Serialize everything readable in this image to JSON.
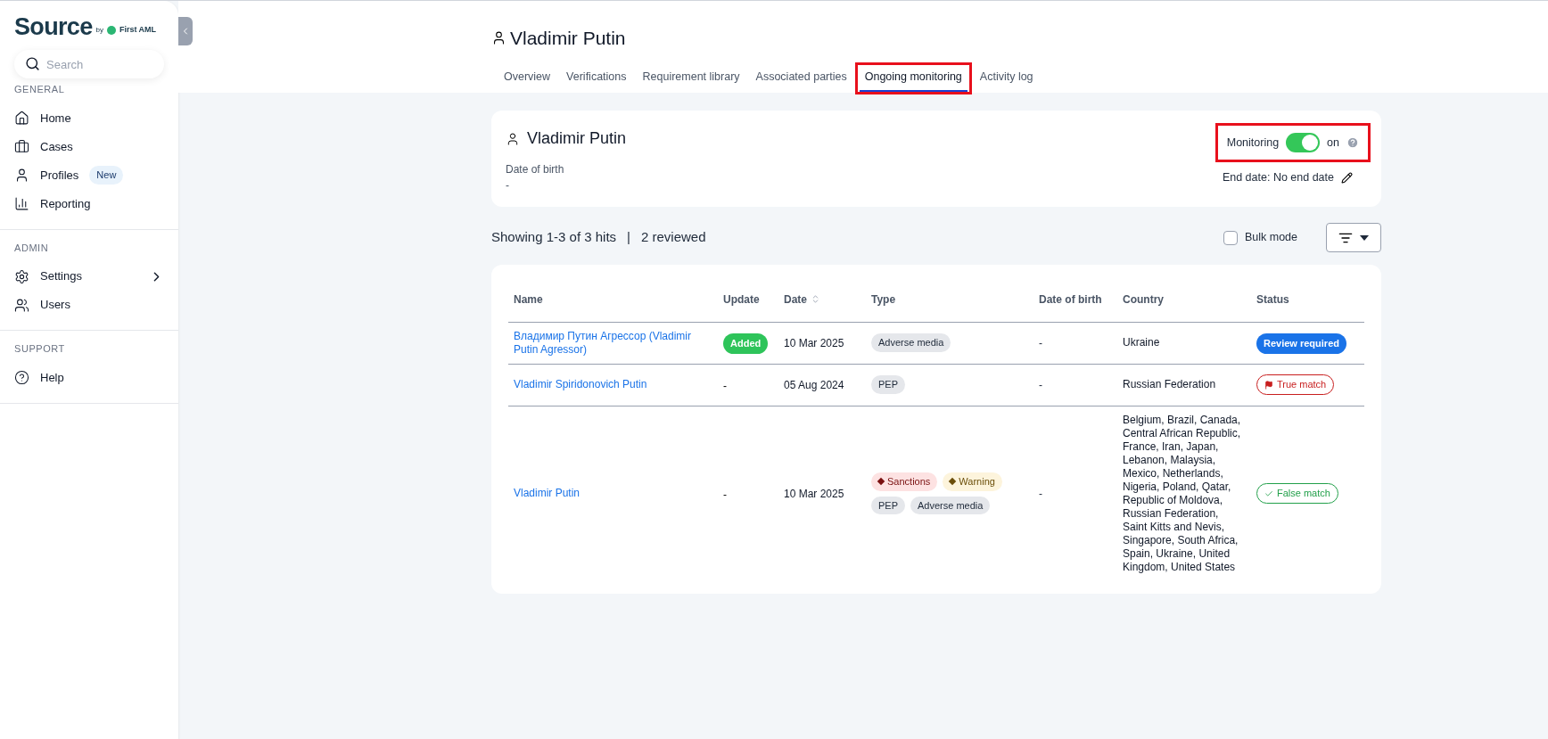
{
  "sidebar": {
    "logo": "Source",
    "logo_by": "by",
    "logo_brand": "First AML",
    "search": {
      "placeholder": "Search"
    },
    "sections": [
      {
        "title": "GENERAL",
        "items": [
          {
            "label": "Home",
            "kind": "home"
          },
          {
            "label": "Cases",
            "kind": "briefcase"
          },
          {
            "label": "Profiles",
            "kind": "user",
            "badge": "New"
          },
          {
            "label": "Reporting",
            "kind": "chart"
          }
        ]
      },
      {
        "title": "ADMIN",
        "items": [
          {
            "label": "Settings",
            "kind": "settings",
            "expandable": true
          },
          {
            "label": "Users",
            "kind": "users"
          }
        ]
      },
      {
        "title": "SUPPORT",
        "items": [
          {
            "label": "Help",
            "kind": "help"
          }
        ]
      }
    ]
  },
  "header": {
    "title": "Vladimir Putin",
    "tabs": [
      {
        "label": "Overview",
        "selected": false,
        "highlighted": false
      },
      {
        "label": "Verifications",
        "selected": false,
        "highlighted": false
      },
      {
        "label": "Requirement library",
        "selected": false,
        "highlighted": false
      },
      {
        "label": "Associated parties",
        "selected": false,
        "highlighted": false
      },
      {
        "label": "Ongoing monitoring",
        "selected": true,
        "highlighted": true
      },
      {
        "label": "Activity log",
        "selected": false,
        "highlighted": false
      }
    ]
  },
  "profile_card": {
    "name": "Vladimir Putin",
    "dob_label": "Date of birth",
    "dob_value": "-",
    "monitoring": {
      "label": "Monitoring",
      "on": true,
      "state_text": "on",
      "highlighted": true
    },
    "end_date": "End date: No end date"
  },
  "summary": {
    "showing": "Showing 1-3 of 3 hits",
    "separator": "|",
    "reviewed": "2 reviewed",
    "bulk_mode": {
      "label": "Bulk mode",
      "checked": false
    }
  },
  "table": {
    "columns": [
      "Name",
      "Update",
      "Date",
      "Type",
      "Date of birth",
      "Country",
      "Status"
    ],
    "rows": [
      {
        "name": "Владимир Путин Агрессор (Vladimir Putin Agressor)",
        "update": {
          "kind": "added",
          "text": "Added"
        },
        "date": "10 Mar 2025",
        "types": [
          {
            "kind": "plain",
            "label": "Adverse media"
          }
        ],
        "dob": "-",
        "country": "Ukraine",
        "status": {
          "kind": "review",
          "label": "Review required"
        }
      },
      {
        "name": "Vladimir Spiridonovich Putin",
        "update": {
          "kind": "none",
          "text": "-"
        },
        "date": "05 Aug 2024",
        "types": [
          {
            "kind": "plain",
            "label": "PEP"
          }
        ],
        "dob": "-",
        "country": "Russian Federation",
        "status": {
          "kind": "true_match",
          "label": "True match"
        }
      },
      {
        "name": "Vladimir Putin",
        "update": {
          "kind": "none",
          "text": "-"
        },
        "date": "10 Mar 2025",
        "types": [
          {
            "kind": "sanctions",
            "label": "Sanctions"
          },
          {
            "kind": "warning",
            "label": "Warning"
          },
          {
            "kind": "plain",
            "label": "PEP"
          },
          {
            "kind": "plain",
            "label": "Adverse media"
          }
        ],
        "dob": "-",
        "country": "Belgium, Brazil, Canada, Central African Republic, France, Iran, Japan, Lebanon, Malaysia, Mexico, Netherlands, Nigeria, Poland, Qatar, Republic of Moldova, Russian Federation, Saint Kitts and Nevis, Singapore, South Africa, Spain, Ukraine, United Kingdom, United States",
        "status": {
          "kind": "false_match",
          "label": "False match"
        }
      }
    ]
  }
}
